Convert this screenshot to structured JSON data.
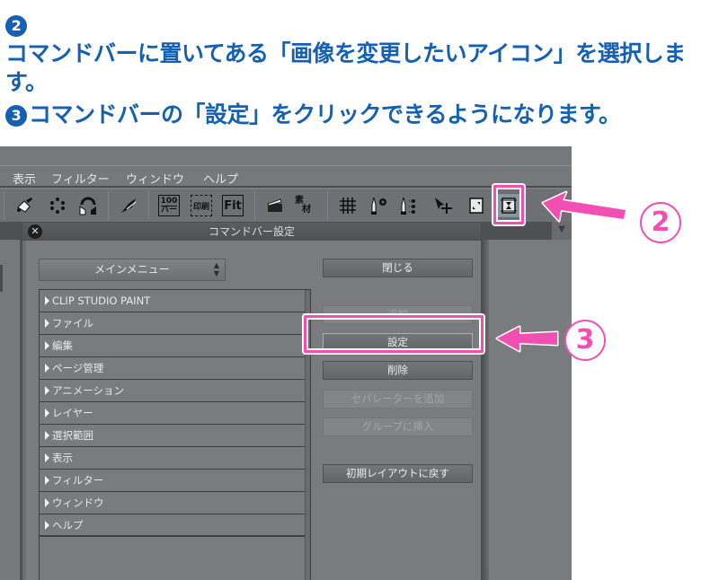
{
  "instructions": [
    {
      "number": "2",
      "text": "コマンドバーに置いてある「画像を変更したいアイコン」を選択します。"
    },
    {
      "number": "3",
      "text": "コマンドバーの「設定」をクリックできるようになります。"
    }
  ],
  "menubar": {
    "items": [
      "表示",
      "フィルター",
      "ウィンドウ",
      "ヘルプ"
    ]
  },
  "toolbar": {
    "icons": [
      {
        "name": "fill-icon",
        "glyph": "✎"
      },
      {
        "name": "dots-icon",
        "glyph": "⁘"
      },
      {
        "name": "rotate-icon",
        "glyph": "↻"
      },
      {
        "name": "pen-icon",
        "glyph": "✐"
      },
      {
        "name": "zoom-100-icon",
        "glyph": "100"
      },
      {
        "name": "print-size-icon",
        "glyph": "印刷"
      },
      {
        "name": "fit-icon",
        "glyph": "Fit"
      },
      {
        "name": "animation-icon",
        "glyph": "🎬"
      },
      {
        "name": "material-icon",
        "glyph": "素材"
      },
      {
        "name": "grid-icon",
        "glyph": "#"
      },
      {
        "name": "tool-settings-icon",
        "glyph": "⚙"
      },
      {
        "name": "tool-property-icon",
        "glyph": "⋮"
      },
      {
        "name": "transform-icon",
        "glyph": "✥"
      },
      {
        "name": "frame-icon",
        "glyph": "▣"
      },
      {
        "name": "hourglass-frame-icon",
        "glyph": "⧗"
      }
    ],
    "selected_index": 14
  },
  "dialog": {
    "title": "コマンドバー設定",
    "close_glyph": "✕",
    "select_value": "メインメニュー",
    "tree_items": [
      "CLIP STUDIO PAINT",
      "ファイル",
      "編集",
      "ページ管理",
      "アニメーション",
      "レイヤー",
      "選択範囲",
      "表示",
      "フィルター",
      "ウィンドウ",
      "ヘルプ"
    ],
    "buttons": {
      "close": "閉じる",
      "add": "追加",
      "settings": "設定",
      "delete": "削除",
      "add_separator": "セパレーターを追加",
      "insert_group": "グループに挿入",
      "reset_layout": "初期レイアウトに戻す"
    }
  },
  "annotations": {
    "step2_label": "2",
    "step3_label": "3",
    "accent_color": "#f24fb3",
    "instruction_color": "#1560b0"
  }
}
